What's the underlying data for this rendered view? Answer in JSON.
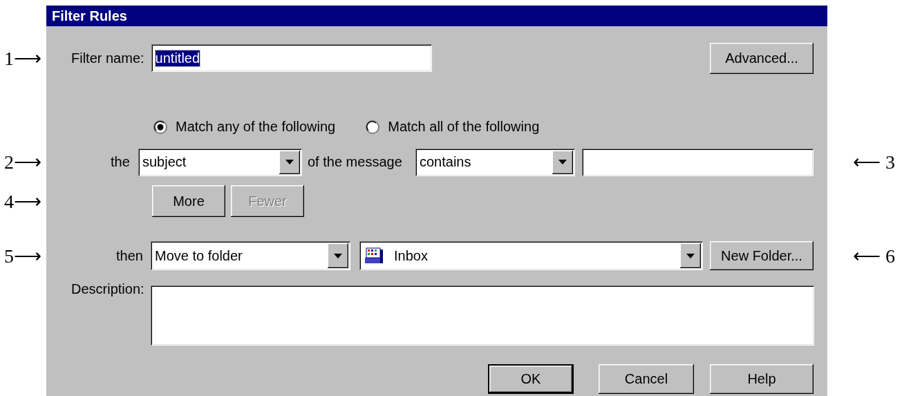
{
  "window": {
    "title": "Filter Rules"
  },
  "filter_name": {
    "annotation": "1⟶",
    "label": "Filter name:",
    "value": "untitled",
    "text_selected": true
  },
  "advanced_button": {
    "label": "Advanced..."
  },
  "match_options": [
    {
      "label": "Match any of the following",
      "selected": true
    },
    {
      "label": "Match all of the following",
      "selected": false
    }
  ],
  "condition": {
    "annotation_left": "2⟶",
    "annotation_right": "⟵ 3",
    "prefix": "the",
    "field": "subject",
    "middle": "of the message",
    "operator": "contains"
  },
  "condition_buttons": {
    "annotation": "4⟶",
    "buttons": [
      {
        "label": "More",
        "disabled": false
      },
      {
        "label": "Fewer",
        "disabled": true
      }
    ]
  },
  "action": {
    "annotation_left": "5⟶",
    "annotation_right": "⟵ 6",
    "prefix": "then",
    "action": "Move to folder",
    "folder": "Inbox",
    "new_folder_button": "New Folder..."
  },
  "description": {
    "label": "Description:"
  },
  "buttons": [
    {
      "label": "OK",
      "default": true
    },
    {
      "label": "Cancel",
      "default": false
    },
    {
      "label": "Help",
      "default": false
    }
  ]
}
